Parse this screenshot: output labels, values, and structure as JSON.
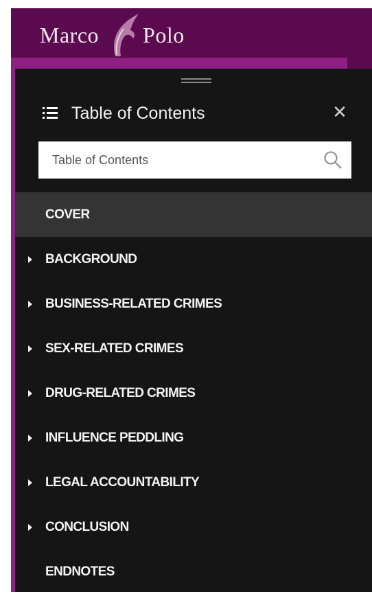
{
  "brand": {
    "word_left": "Marco",
    "word_right": "Polo",
    "header_color": "#5c0a4f",
    "accent_color": "#8e1f83"
  },
  "toc": {
    "title": "Table of Contents",
    "menu_icon": "list-icon",
    "close_icon": "close-icon"
  },
  "search": {
    "placeholder": "Table of Contents",
    "icon": "search-icon"
  },
  "items": [
    {
      "label": "COVER",
      "has_children": false,
      "selected": true
    },
    {
      "label": "BACKGROUND",
      "has_children": true,
      "selected": false
    },
    {
      "label": "BUSINESS-RELATED CRIMES",
      "has_children": true,
      "selected": false
    },
    {
      "label": "SEX-RELATED CRIMES",
      "has_children": true,
      "selected": false
    },
    {
      "label": "DRUG-RELATED CRIMES",
      "has_children": true,
      "selected": false
    },
    {
      "label": "INFLUENCE PEDDLING",
      "has_children": true,
      "selected": false
    },
    {
      "label": "LEGAL ACCOUNTABILITY",
      "has_children": true,
      "selected": false
    },
    {
      "label": "CONCLUSION",
      "has_children": true,
      "selected": false
    },
    {
      "label": "ENDNOTES",
      "has_children": false,
      "selected": false
    }
  ]
}
